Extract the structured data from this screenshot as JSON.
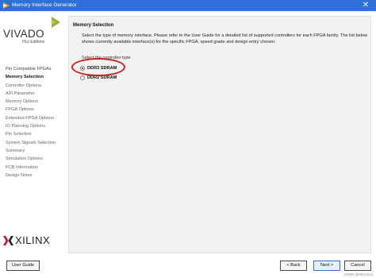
{
  "window": {
    "title": "Memory Interface Generator"
  },
  "logo": {
    "product": "VIVADO",
    "edition": "HLx Editions",
    "vendor": "XILINX"
  },
  "sidebar": {
    "items": [
      {
        "label": "Pin Compatible FPGAs",
        "active": false
      },
      {
        "label": "Memory Selection",
        "active": true
      },
      {
        "label": "Controller Options",
        "active": false
      },
      {
        "label": "AXI Parameter",
        "active": false
      },
      {
        "label": "Memory Options",
        "active": false
      },
      {
        "label": "FPGA Options",
        "active": false
      },
      {
        "label": "Extended FPGA Options",
        "active": false
      },
      {
        "label": "IO Planning Options",
        "active": false
      },
      {
        "label": "Pin Selection",
        "active": false
      },
      {
        "label": "System Signals Selection",
        "active": false
      },
      {
        "label": "Summary",
        "active": false
      },
      {
        "label": "Simulation Options",
        "active": false
      },
      {
        "label": "PCB Information",
        "active": false
      },
      {
        "label": "Design Notes",
        "active": false
      }
    ]
  },
  "main": {
    "heading": "Memory Selection",
    "description": "Select the type of memory interface. Please refer to the User Guide for a detailed list of supported controllers for each FPGA family. The list below shows currently available interface(s) for the specific FPGA, speed grade and design entry chosen.",
    "select_label": "Select the controller type",
    "options": [
      {
        "label": "DDR3 SDRAM",
        "selected": true
      },
      {
        "label": "DDR2 SDRAM",
        "selected": false
      }
    ]
  },
  "buttons": {
    "user_guide": "User Guide",
    "back": "< Back",
    "next": "Next >",
    "cancel": "Cancel"
  },
  "watermark": "CSDN @IW-Lince",
  "colors": {
    "titlebar": "#2f6fd8",
    "highlight": "#cc1f1f"
  }
}
